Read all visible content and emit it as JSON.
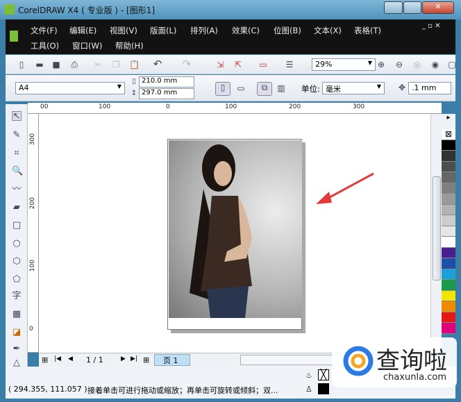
{
  "window": {
    "title": "CorelDRAW X4 ( 专业版 ) - [图形1]"
  },
  "menu": [
    "文件(F)",
    "编辑(E)",
    "视图(V)",
    "版面(L)",
    "排列(A)",
    "效果(C)",
    "位图(B)",
    "文本(X)",
    "表格(T)",
    "工具(O)",
    "窗口(W)",
    "帮助(H)"
  ],
  "toolbar": {
    "zoom": "29%"
  },
  "property_bar": {
    "paper": "A4",
    "width": "210.0 mm",
    "height": "297.0 mm",
    "unit_label": "单位:",
    "unit": "毫米",
    "nudge": ".1 mm"
  },
  "ruler": {
    "h": [
      "00",
      "100",
      "0",
      "100",
      "200",
      "300"
    ],
    "v": [
      "300",
      "200",
      "100",
      "0"
    ]
  },
  "page_nav": {
    "counter": "1 / 1",
    "tab": "页 1"
  },
  "status": {
    "coords": "( 294.355, 111.057 )",
    "message": "接着单击可进行拖动或缩放；再单击可旋转或倾斜；双..."
  },
  "watermark": {
    "brand": "查询啦",
    "url": "chaxunla.com"
  },
  "colors": {
    "arrow": "#e23a3a",
    "palette": [
      "#000000",
      "#333333",
      "#4d4d4d",
      "#666666",
      "#808080",
      "#999999",
      "#b3b3b3",
      "#cccccc",
      "#e6e6e6",
      "#ffffff",
      "#4b1e8f",
      "#1e4fa8",
      "#1aa0d8",
      "#1a9a4a",
      "#f2e600",
      "#f08a00",
      "#e01818",
      "#e0007a"
    ]
  }
}
